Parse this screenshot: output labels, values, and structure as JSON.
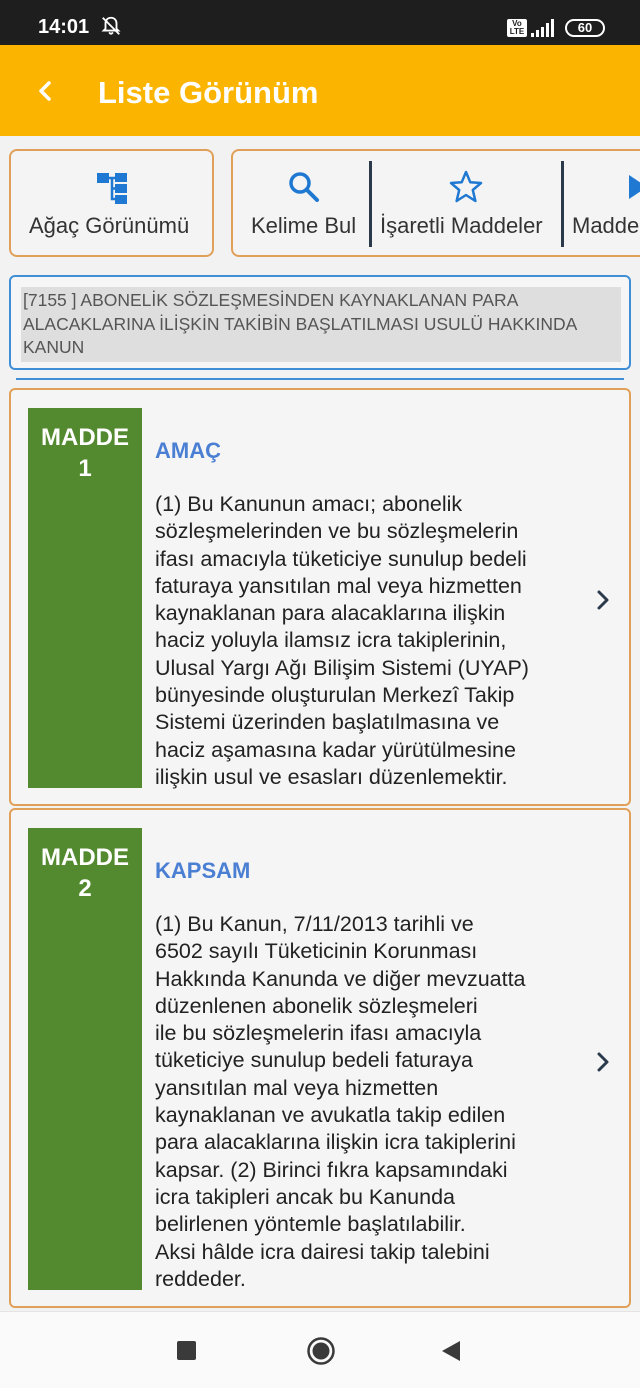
{
  "status_bar": {
    "time": "14:01",
    "volte": "Vo LTE",
    "battery": "60",
    "icons": [
      "bell-off-icon",
      "signal-icon",
      "battery-icon"
    ]
  },
  "app_bar": {
    "title": "Liste Görünüm",
    "back_icon": "chevron-left-icon",
    "color": "#fbb500"
  },
  "tools": {
    "tree_view": {
      "label": "Ağaç Görünümü",
      "icon": "tree-icon"
    },
    "find_word": {
      "label": "Kelime Bul",
      "icon": "search-icon"
    },
    "marked": {
      "label": "İşaretli Maddeler",
      "icon": "star-icon"
    },
    "articles": {
      "label": "Madde",
      "icon": "play-icon"
    }
  },
  "law": {
    "title": "[7155 ] ABONELİK SÖZLEŞMESİNDEN KAYNAKLANAN PARA ALACAKLARINA İLİŞKİN TAKİBİN BAŞLATILMASI USULÜ HAKKINDA KANUN"
  },
  "articles": [
    {
      "madde": "MADDE",
      "number": "1",
      "title": "AMAÇ",
      "body": "(1) Bu Kanunun amacı; abonelik\nsözleşmelerinden ve bu sözleşmelerin\nifası amacıyla tüketiciye sunulup bedeli\nfaturaya yansıtılan mal veya hizmetten\nkaynaklanan para alacaklarına ilişkin\nhaciz yoluyla ilamsız icra takiplerinin,\nUlusal Yargı Ağı Bilişim Sistemi (UYAP)\nbünyesinde oluşturulan Merkezî Takip\nSistemi üzerinden başlatılmasına ve\nhaciz aşamasına kadar yürütülmesine\nilişkin usul ve esasları düzenlemektir."
    },
    {
      "madde": "MADDE",
      "number": "2",
      "title": "KAPSAM",
      "body": "(1) Bu Kanun, 7/11/2013 tarihli ve\n6502 sayılı Tüketicinin Korunması\nHakkında Kanunda ve diğer mevzuatta\ndüzenlenen abonelik sözleşmeleri\nile bu sözleşmelerin ifası amacıyla\ntüketiciye sunulup bedeli faturaya\nyansıtılan mal veya hizmetten\nkaynaklanan ve avukatla takip edilen\npara alacaklarına ilişkin icra takiplerini\nkapsar. (2) Birinci fıkra kapsamındaki\nicra takipleri ancak bu Kanunda\nbelirlenen yöntemle başlatılabilir.\nAksi hâlde icra dairesi takip talebini\nreddeder."
    }
  ],
  "colors": {
    "madde_green": "#548a2f",
    "title_blue": "#4a7fd3",
    "card_border": "#e0a05a",
    "accent_blue": "#3f8fd6"
  },
  "nav_bar": {
    "icons": [
      "recents-square-icon",
      "home-circle-icon",
      "back-triangle-icon"
    ]
  }
}
